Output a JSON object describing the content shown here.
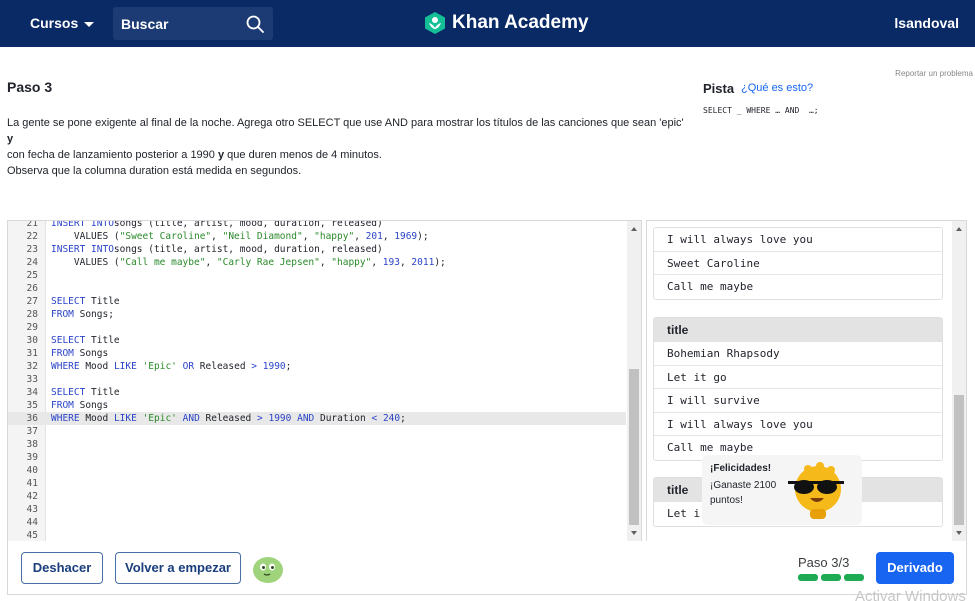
{
  "nav": {
    "courses_label": "Cursos",
    "search_placeholder": "Buscar",
    "brand_name": "Khan Academy",
    "user_name": "lsandoval"
  },
  "challenge": {
    "report_link": "Reportar un problema",
    "step_title": "Paso 3",
    "instructions": [
      {
        "text": "La gente se pone exigente al final de la noche. Agrega otro SELECT que use AND para mostrar los títulos de las canciones que sean 'epic' "
      },
      {
        "text": "y",
        "bold": true
      },
      {
        "text": "con fecha de lanzamiento posterior a 1990 "
      },
      {
        "text": "y",
        "bold": true
      },
      {
        "text": " que duren menos de 4 minutos."
      },
      {
        "text": "Observa que la columna duration está medida en segundos."
      }
    ],
    "hint_title": "Pista",
    "hint_link": "¿Qué es esto?",
    "hint_code": "SELECT _ WHERE … AND  …;"
  },
  "editor": {
    "lines": [
      {
        "n": "21",
        "tokens": [
          [
            "kw",
            "INSERT INTO"
          ],
          [
            "",
            "songs (title, artist, mood, duration, released)"
          ]
        ]
      },
      {
        "n": "22",
        "tokens": [
          [
            "",
            "    VALUES ("
          ],
          [
            "str",
            "\"Sweet Caroline\""
          ],
          [
            "",
            ", "
          ],
          [
            "str",
            "\"Neil Diamond\""
          ],
          [
            "",
            ", "
          ],
          [
            "str",
            "\"happy\""
          ],
          [
            "",
            ", "
          ],
          [
            "num",
            "201"
          ],
          [
            "",
            ", "
          ],
          [
            "num",
            "1969"
          ],
          [
            "",
            ");"
          ]
        ]
      },
      {
        "n": "23",
        "tokens": [
          [
            "kw",
            "INSERT INTO"
          ],
          [
            "",
            ""
          ],
          [
            "",
            "songs (title, artist, mood, duration, released)"
          ]
        ]
      },
      {
        "n": "24",
        "tokens": [
          [
            "",
            "    VALUES ("
          ],
          [
            "str",
            "\"Call me maybe\""
          ],
          [
            "",
            ", "
          ],
          [
            "str",
            "\"Carly Rae Jepsen\""
          ],
          [
            "",
            ", "
          ],
          [
            "str",
            "\"happy\""
          ],
          [
            "",
            ", "
          ],
          [
            "num",
            "193"
          ],
          [
            "",
            ", "
          ],
          [
            "num",
            "2011"
          ],
          [
            "",
            ");"
          ]
        ]
      },
      {
        "n": "25",
        "tokens": []
      },
      {
        "n": "26",
        "tokens": []
      },
      {
        "n": "27",
        "tokens": [
          [
            "kw",
            "SELECT"
          ],
          [
            "",
            " Title"
          ]
        ]
      },
      {
        "n": "28",
        "tokens": [
          [
            "kw",
            "FROM"
          ],
          [
            "",
            " Songs;"
          ]
        ]
      },
      {
        "n": "29",
        "tokens": []
      },
      {
        "n": "30",
        "tokens": [
          [
            "kw",
            "SELECT"
          ],
          [
            "",
            " Title"
          ]
        ]
      },
      {
        "n": "31",
        "tokens": [
          [
            "kw",
            "FROM"
          ],
          [
            "",
            " Songs"
          ]
        ]
      },
      {
        "n": "32",
        "tokens": [
          [
            "kw",
            "WHERE"
          ],
          [
            "",
            " Mood "
          ],
          [
            "kw",
            "LIKE"
          ],
          [
            "",
            " "
          ],
          [
            "str",
            "'Epic'"
          ],
          [
            "",
            " "
          ],
          [
            "kw",
            "OR"
          ],
          [
            "",
            " Released "
          ],
          [
            "kw",
            ">"
          ],
          [
            "",
            " "
          ],
          [
            "num",
            "1990"
          ],
          [
            "",
            ";"
          ]
        ]
      },
      {
        "n": "33",
        "tokens": []
      },
      {
        "n": "34",
        "tokens": [
          [
            "kw",
            "SELECT"
          ],
          [
            "",
            " Title"
          ]
        ]
      },
      {
        "n": "35",
        "tokens": [
          [
            "kw",
            "FROM"
          ],
          [
            "",
            " Songs"
          ]
        ]
      },
      {
        "n": "36",
        "active": true,
        "tokens": [
          [
            "kw",
            "WHERE"
          ],
          [
            "",
            " Mood "
          ],
          [
            "kw",
            "LIKE"
          ],
          [
            "",
            " "
          ],
          [
            "str",
            "'Epic'"
          ],
          [
            "",
            " "
          ],
          [
            "kw",
            "AND"
          ],
          [
            "",
            " Released "
          ],
          [
            "kw",
            ">"
          ],
          [
            "",
            " "
          ],
          [
            "num",
            "1990"
          ],
          [
            "",
            " "
          ],
          [
            "kw",
            "AND"
          ],
          [
            "",
            " Duration "
          ],
          [
            "kw",
            "<"
          ],
          [
            "",
            " "
          ],
          [
            "num",
            "240"
          ],
          [
            "",
            ";"
          ]
        ]
      },
      {
        "n": "37",
        "tokens": []
      },
      {
        "n": "38",
        "tokens": []
      },
      {
        "n": "39",
        "tokens": []
      },
      {
        "n": "40",
        "tokens": []
      },
      {
        "n": "41",
        "tokens": []
      },
      {
        "n": "42",
        "tokens": []
      },
      {
        "n": "43",
        "tokens": []
      },
      {
        "n": "44",
        "tokens": []
      },
      {
        "n": "45",
        "tokens": []
      }
    ]
  },
  "output": {
    "tables": [
      {
        "header": null,
        "rows": [
          "I will always love you",
          "Sweet Caroline",
          "Call me maybe"
        ]
      },
      {
        "header": "title",
        "rows": [
          "Bohemian Rhapsody",
          "Let it go",
          "I will survive",
          "I will always love you",
          "Call me maybe"
        ]
      },
      {
        "header": "title",
        "rows": [
          "Let i"
        ]
      }
    ]
  },
  "congrats": {
    "title": "¡Felicidades!",
    "text": "¡Ganaste 2100 puntos!"
  },
  "footer": {
    "undo_label": "Deshacer",
    "restart_label": "Volver a empezar",
    "step_count": "Paso 3/3",
    "steps_completed": 3,
    "steps_total": 3,
    "primary_label": "Derivado"
  },
  "os_watermark": "Activar Windows",
  "colors": {
    "nav_bg": "#0a2a66",
    "brand_green": "#14bf96",
    "primary_blue": "#1865f2",
    "progress_green": "#1fab54"
  }
}
